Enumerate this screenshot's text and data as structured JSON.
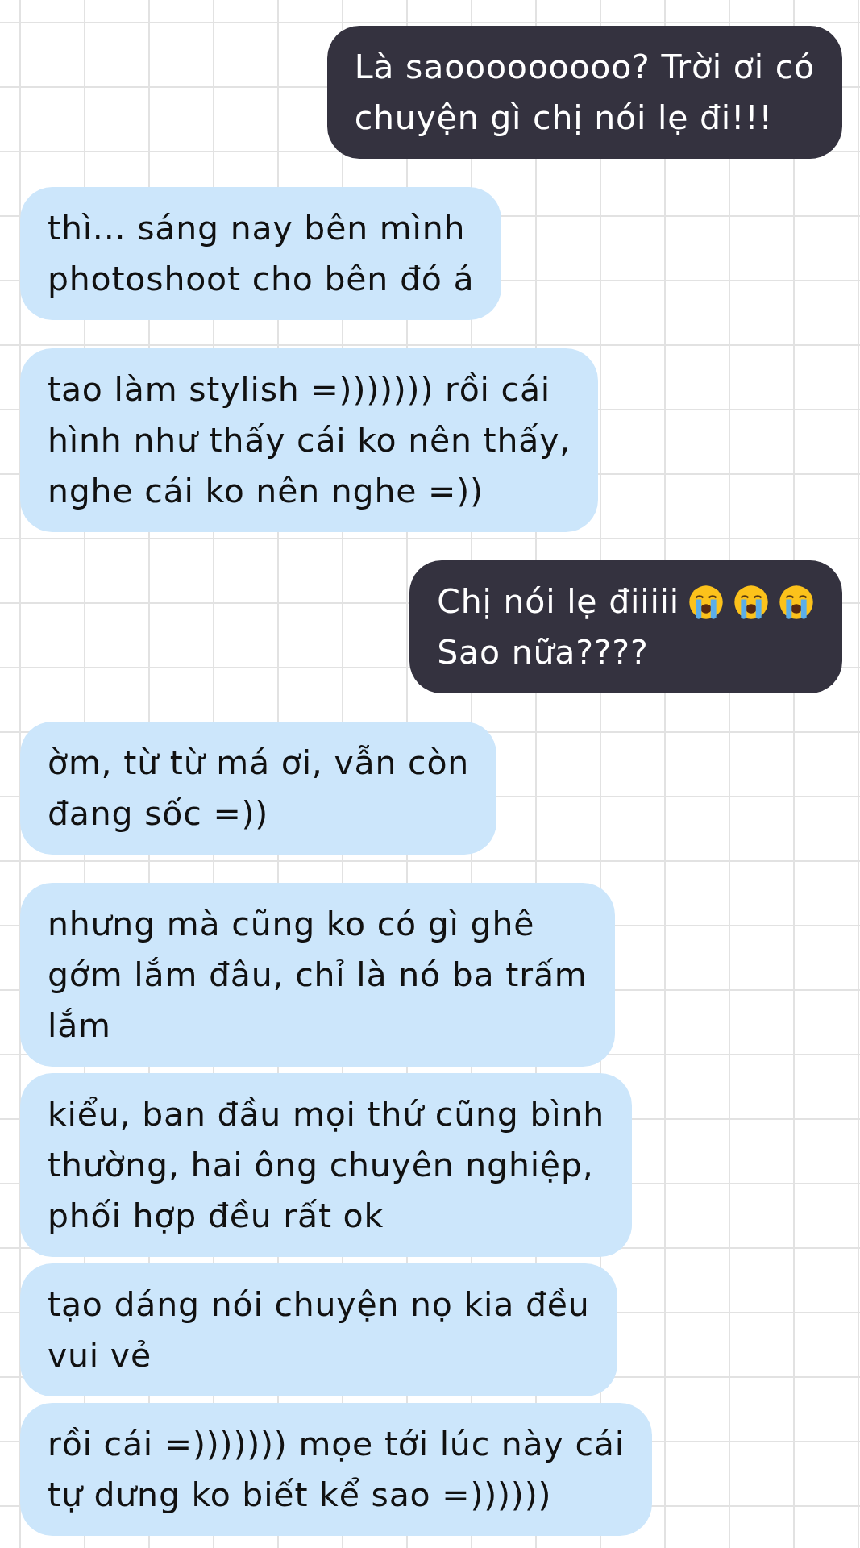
{
  "groups": [
    {
      "messages": [
        {
          "kind": "outgoing",
          "lines": [
            [
              {
                "kind": "text",
                "text": "Là saooooooooo? Trời ơi có"
              }
            ],
            [
              {
                "kind": "text",
                "text": "chuyện gì chị nói lẹ đi!!!"
              }
            ]
          ]
        }
      ]
    },
    {
      "messages": [
        {
          "kind": "incoming",
          "lines": [
            [
              {
                "kind": "text",
                "text": "thì... sáng nay bên mình"
              }
            ],
            [
              {
                "kind": "text",
                "text": "photoshoot cho bên đó á"
              }
            ]
          ]
        }
      ]
    },
    {
      "messages": [
        {
          "kind": "incoming",
          "lines": [
            [
              {
                "kind": "text",
                "text": "tao làm stylish =))))))) rồi cái"
              }
            ],
            [
              {
                "kind": "text",
                "text": "hình như thấy cái ko nên thấy,"
              }
            ],
            [
              {
                "kind": "text",
                "text": "nghe cái ko nên nghe =))"
              }
            ]
          ]
        }
      ]
    },
    {
      "messages": [
        {
          "kind": "outgoing",
          "lines": [
            [
              {
                "kind": "text",
                "text": "Chị nói lẹ điiiii"
              },
              {
                "kind": "emoji"
              },
              {
                "kind": "emoji"
              },
              {
                "kind": "emoji"
              }
            ],
            [
              {
                "kind": "text",
                "text": "Sao nữa????"
              }
            ]
          ]
        }
      ]
    },
    {
      "messages": [
        {
          "kind": "incoming",
          "lines": [
            [
              {
                "kind": "text",
                "text": "ờm, từ từ má ơi, vẫn còn"
              }
            ],
            [
              {
                "kind": "text",
                "text": "đang sốc =))"
              }
            ]
          ]
        }
      ]
    },
    {
      "messages": [
        {
          "kind": "incoming",
          "lines": [
            [
              {
                "kind": "text",
                "text": "nhưng mà cũng ko có gì ghê"
              }
            ],
            [
              {
                "kind": "text",
                "text": "gớm lắm đâu, chỉ là nó ba trấm"
              }
            ],
            [
              {
                "kind": "text",
                "text": "lắm"
              }
            ]
          ]
        },
        {
          "kind": "incoming",
          "lines": [
            [
              {
                "kind": "text",
                "text": "kiểu, ban đầu mọi thứ cũng bình"
              }
            ],
            [
              {
                "kind": "text",
                "text": "thường, hai ông chuyên nghiệp,"
              }
            ],
            [
              {
                "kind": "text",
                "text": "phối hợp đều rất ok"
              }
            ]
          ]
        },
        {
          "kind": "incoming",
          "lines": [
            [
              {
                "kind": "text",
                "text": "tạo dáng nói chuyện nọ kia đều"
              }
            ],
            [
              {
                "kind": "text",
                "text": "vui vẻ"
              }
            ]
          ]
        },
        {
          "kind": "incoming",
          "lines": [
            [
              {
                "kind": "text",
                "text": "rồi cái =))))))) mọe tới lúc này cái"
              }
            ],
            [
              {
                "kind": "text",
                "text": "tự dưng ko biết kể sao =))))))"
              }
            ]
          ]
        }
      ]
    }
  ]
}
